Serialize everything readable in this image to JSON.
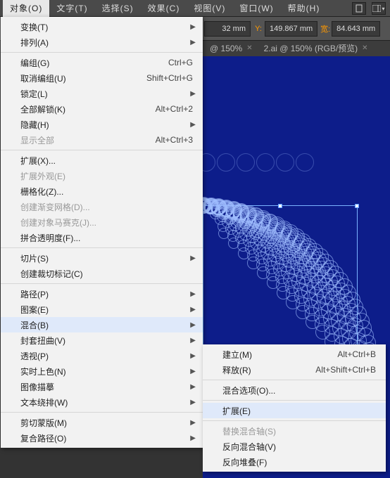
{
  "menubar": {
    "items": [
      "对象(O)",
      "文字(T)",
      "选择(S)",
      "效果(C)",
      "视图(V)",
      "窗口(W)",
      "帮助(H)"
    ],
    "active_index": 0
  },
  "toolstrip": {
    "x_unit": "32 mm",
    "y_label": "Y:",
    "y_value": "149.867 mm",
    "w_label": "宽:",
    "w_value": "84.643 mm"
  },
  "tabs": [
    {
      "label": "@ 150%"
    },
    {
      "label": "2.ai @ 150% (RGB/预览)"
    }
  ],
  "menu": {
    "sections": [
      [
        {
          "label": "变换(T)",
          "submenu": true
        },
        {
          "label": "排列(A)",
          "submenu": true
        }
      ],
      [
        {
          "label": "编组(G)",
          "shortcut": "Ctrl+G"
        },
        {
          "label": "取消编组(U)",
          "shortcut": "Shift+Ctrl+G"
        },
        {
          "label": "锁定(L)",
          "submenu": true
        },
        {
          "label": "全部解锁(K)",
          "shortcut": "Alt+Ctrl+2"
        },
        {
          "label": "隐藏(H)",
          "submenu": true
        },
        {
          "label": "显示全部",
          "shortcut": "Alt+Ctrl+3",
          "disabled": true
        }
      ],
      [
        {
          "label": "扩展(X)..."
        },
        {
          "label": "扩展外观(E)",
          "disabled": true
        },
        {
          "label": "栅格化(Z)..."
        },
        {
          "label": "创建渐变网格(D)...",
          "disabled": true
        },
        {
          "label": "创建对象马赛克(J)...",
          "disabled": true
        },
        {
          "label": "拼合透明度(F)..."
        }
      ],
      [
        {
          "label": "切片(S)",
          "submenu": true
        },
        {
          "label": "创建裁切标记(C)"
        }
      ],
      [
        {
          "label": "路径(P)",
          "submenu": true
        },
        {
          "label": "图案(E)",
          "submenu": true
        },
        {
          "label": "混合(B)",
          "submenu": true,
          "hover": true
        },
        {
          "label": "封套扭曲(V)",
          "submenu": true
        },
        {
          "label": "透视(P)",
          "submenu": true
        },
        {
          "label": "实时上色(N)",
          "submenu": true
        },
        {
          "label": "图像描摹",
          "submenu": true
        },
        {
          "label": "文本绕排(W)",
          "submenu": true
        }
      ],
      [
        {
          "label": "剪切蒙版(M)",
          "submenu": true
        },
        {
          "label": "复合路径(O)",
          "submenu": true
        }
      ]
    ]
  },
  "submenu": {
    "sections": [
      [
        {
          "label": "建立(M)",
          "shortcut": "Alt+Ctrl+B"
        },
        {
          "label": "释放(R)",
          "shortcut": "Alt+Shift+Ctrl+B"
        }
      ],
      [
        {
          "label": "混合选项(O)..."
        }
      ],
      [
        {
          "label": "扩展(E)",
          "hover": true
        }
      ],
      [
        {
          "label": "替换混合轴(S)",
          "disabled": true
        },
        {
          "label": "反向混合轴(V)"
        },
        {
          "label": "反向堆叠(F)"
        }
      ]
    ]
  }
}
